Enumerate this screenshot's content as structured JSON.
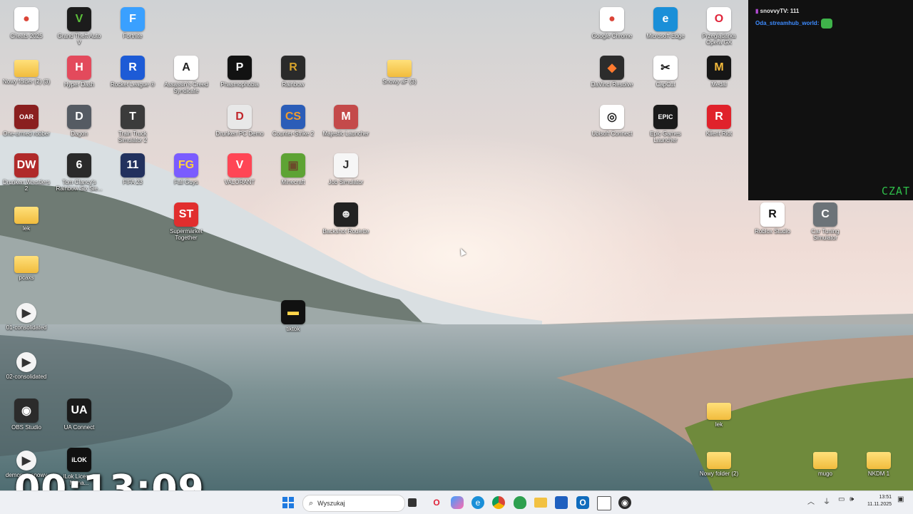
{
  "desktop_icons": [
    {
      "label": "Cheats 2025",
      "bg": "#ffffff",
      "glyph": "●",
      "color": "#db4437"
    },
    {
      "label": "Grand Theft Auto V",
      "bg": "#1c1c1c",
      "glyph": "V",
      "color": "#5bbf3a"
    },
    {
      "label": "Fortnite",
      "bg": "#3aa0ff",
      "glyph": "F",
      "color": "#ffffff"
    },
    {
      "label": "Google Chrome",
      "bg": "#ffffff",
      "glyph": "●",
      "color": "#db4437"
    },
    {
      "label": "Microsoft Edge",
      "bg": "#1a8fd8",
      "glyph": "e",
      "color": "#ffffff"
    },
    {
      "label": "Przeglądarka Opera GX",
      "bg": "#ffffff",
      "glyph": "O",
      "color": "#e0243a"
    },
    {
      "label": "Nowy folder (2) (3)",
      "folder": true
    },
    {
      "label": "Hyper Dash",
      "bg": "#e34a5c",
      "glyph": "H",
      "color": "#ffffff"
    },
    {
      "label": "Rocket League ®",
      "bg": "#1d5bd6",
      "glyph": "R",
      "color": "#ffffff"
    },
    {
      "label": "Assassin's Creed Syndicate",
      "bg": "#ffffff",
      "glyph": "A",
      "color": "#222222"
    },
    {
      "label": "Phasmophobia",
      "bg": "#121212",
      "glyph": "P",
      "color": "#ffffff"
    },
    {
      "label": "Rainbow",
      "bg": "#2a2a2a",
      "glyph": "R",
      "color": "#d7a32c"
    },
    {
      "label": "Snowy aF (3)",
      "folder": true
    },
    {
      "label": "DaVinci Resolve",
      "bg": "#2c2c2c",
      "glyph": "◆",
      "color": "#ff7a2f"
    },
    {
      "label": "CapCut",
      "bg": "#ffffff",
      "glyph": "✂",
      "color": "#111111"
    },
    {
      "label": "Medal",
      "bg": "#161616",
      "glyph": "M",
      "color": "#f2b93b"
    },
    {
      "label": "One-armed robber",
      "bg": "#8a1f1f",
      "glyph": "OAR",
      "color": "#ffffff"
    },
    {
      "label": "Dagon",
      "bg": "#555b63",
      "glyph": "D",
      "color": "#ffffff"
    },
    {
      "label": "Train Truck Simulator 2",
      "bg": "#3b3b3b",
      "glyph": "T",
      "color": "#ffffff"
    },
    {
      "label": "Drunken PC Demo",
      "bg": "#e8e8e8",
      "glyph": "D",
      "color": "#c0262b"
    },
    {
      "label": "Counter-Strike 2",
      "bg": "#2b5db8",
      "glyph": "CS",
      "color": "#f19b2c"
    },
    {
      "label": "Majestic Launcher",
      "bg": "#c44a4a",
      "glyph": "M",
      "color": "#ffffff"
    },
    {
      "label": "Ubisoft Connect",
      "bg": "#ffffff",
      "glyph": "◎",
      "color": "#222222"
    },
    {
      "label": "Epic Games Launcher",
      "bg": "#1a1a1a",
      "glyph": "EPIC",
      "color": "#ffffff"
    },
    {
      "label": "Klient Riot",
      "bg": "#e0222b",
      "glyph": "R",
      "color": "#ffffff"
    },
    {
      "label": "Drunken Wrestlers 2",
      "bg": "#b02a2a",
      "glyph": "DW",
      "color": "#ffffff"
    },
    {
      "label": "Tom Clancy's Rainbow Six Sie...",
      "bg": "#2a2a2a",
      "glyph": "6",
      "color": "#ffffff"
    },
    {
      "label": "FIFA 23",
      "bg": "#22315e",
      "glyph": "11",
      "color": "#ffffff"
    },
    {
      "label": "Fall Guys",
      "bg": "#7a5cff",
      "glyph": "FG",
      "color": "#ffd23d"
    },
    {
      "label": "VALORANT",
      "bg": "#ff4655",
      "glyph": "V",
      "color": "#ffffff"
    },
    {
      "label": "Minecraft",
      "bg": "#5ea334",
      "glyph": "▣",
      "color": "#6b4a2a"
    },
    {
      "label": "Job Simulator",
      "bg": "#f6f6f6",
      "glyph": "J",
      "color": "#333333"
    },
    {
      "label": "Roblox Studio",
      "bg": "#ffffff",
      "glyph": "R",
      "color": "#111111"
    },
    {
      "label": "Car Tuning Simulator",
      "bg": "#6c7378",
      "glyph": "C",
      "color": "#ffffff"
    },
    {
      "label": "lek",
      "folder": true
    },
    {
      "label": "Supermarket Together",
      "bg": "#e12e2e",
      "glyph": "ST",
      "color": "#ffffff"
    },
    {
      "label": "Backshot Roulette",
      "bg": "#222222",
      "glyph": "☻",
      "color": "#dddddd"
    },
    {
      "label": "pcaxs",
      "folder": true
    },
    {
      "label": "01-consolidated",
      "video": true
    },
    {
      "label": "tiktok",
      "bg": "#111111",
      "glyph": "▬",
      "color": "#ffd54a"
    },
    {
      "label": "02-consolidated",
      "video": true
    },
    {
      "label": "OBS Studio",
      "bg": "#2b2b2b",
      "glyph": "◉",
      "color": "#ffffff"
    },
    {
      "label": "UA Connect",
      "bg": "#1a1a1a",
      "glyph": "UA",
      "color": "#ffffff"
    },
    {
      "label": "lek",
      "folder": true
    },
    {
      "label": "demony - snowy",
      "video": true
    },
    {
      "label": "iLok License Mana...",
      "bg": "#111111",
      "glyph": "iLOK",
      "color": "#ffffff"
    },
    {
      "label": "Nowy folder (2)",
      "folder": true
    },
    {
      "label": "mugo",
      "folder": true
    },
    {
      "label": "NKDM 1",
      "folder": true
    }
  ],
  "chat": {
    "lines": [
      {
        "user": "snovvyTV",
        "text": "111"
      },
      {
        "user": "Oda_streamhub_world",
        "text": ""
      }
    ],
    "label": "CZAT"
  },
  "timer": "00:13:09",
  "taskbar": {
    "search_placeholder": "Wyszukaj",
    "date": "11.11.2025",
    "time": "13:51",
    "apps": [
      "Opera GX",
      "Copilot",
      "Edge",
      "Chrome",
      "Brave",
      "Explorer",
      "Store",
      "Outlook",
      "Terminal",
      "OBS"
    ]
  }
}
